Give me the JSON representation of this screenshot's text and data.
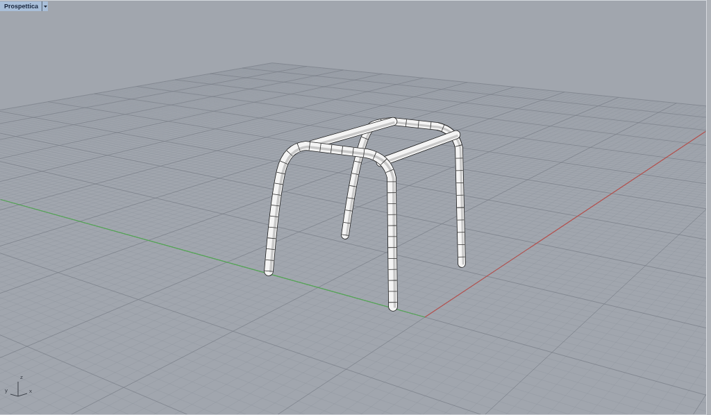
{
  "viewport": {
    "title": "Prospettica",
    "world_axes": [
      {
        "kind": "x",
        "color": "#b8524e"
      },
      {
        "kind": "y",
        "color": "#52a852"
      }
    ],
    "axis_icon": {
      "labels": [
        {
          "kind": "z",
          "text": "z"
        },
        {
          "kind": "y",
          "text": "y"
        },
        {
          "kind": "x",
          "text": "x"
        }
      ]
    }
  }
}
